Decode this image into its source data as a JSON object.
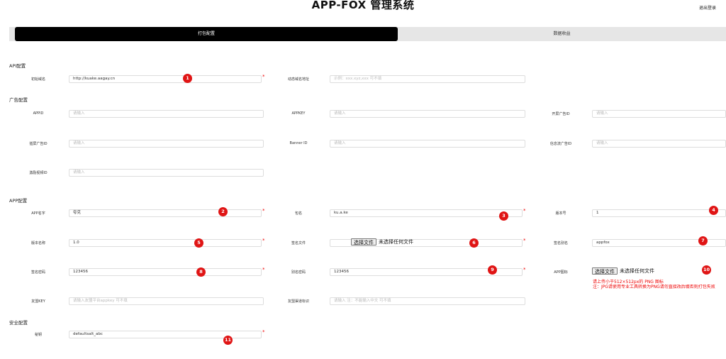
{
  "header": {
    "title": "APP-FOX 管理系统",
    "logout": "退出登录"
  },
  "tabs": [
    {
      "label": "打包配置"
    },
    {
      "label": "数据收益"
    }
  ],
  "sections": {
    "api": "API配置",
    "ad": "广告配置",
    "app": "APP配置",
    "security": "安全配置"
  },
  "fields": {
    "init_domain": {
      "label": "初始域名",
      "value": "http://kuake.aagay.cn"
    },
    "dynamic_domain": {
      "label": "动态域名地址",
      "placeholder": "示例：xxx.xyz,xxx 可不填"
    },
    "appid": {
      "label": "APPID",
      "placeholder": "请输入"
    },
    "appkey": {
      "label": "APPKEY",
      "placeholder": "请输入"
    },
    "splash_ad": {
      "label": "开屏广告ID",
      "placeholder": "请输入"
    },
    "interstitial_ad": {
      "label": "插屏广告ID",
      "placeholder": "请输入"
    },
    "banner_id": {
      "label": "Banner ID",
      "placeholder": "请输入"
    },
    "feed_ad": {
      "label": "信息流广告ID",
      "placeholder": "请输入"
    },
    "reward_video": {
      "label": "激励视频ID",
      "placeholder": "请输入"
    },
    "app_name": {
      "label": "APP名字",
      "value": "夸克"
    },
    "package_name": {
      "label": "包名",
      "value": "ku.a.ke"
    },
    "version_code": {
      "label": "版本号",
      "value": "1"
    },
    "version_name": {
      "label": "版本名称",
      "value": "1.0"
    },
    "sign_file": {
      "label": "签名文件",
      "button": "选择文件",
      "status": "未选择任何文件"
    },
    "sign_alias": {
      "label": "签名别名",
      "value": "appfox"
    },
    "sign_password": {
      "label": "签名密码",
      "value": "123456"
    },
    "alias_password": {
      "label": "别名密码",
      "value": "123456"
    },
    "app_icon": {
      "label": "APP图标",
      "button": "选择文件",
      "status": "未选择任何文件"
    },
    "umeng_key": {
      "label": "友盟KEY",
      "placeholder": "请输入友盟平台appkey 可不填"
    },
    "umeng_channel": {
      "label": "友盟渠道标识",
      "placeholder": "请输入 注：不能输入中文 可不填"
    },
    "secret": {
      "label": "秘钥",
      "value": "defaultsalt_abc"
    }
  },
  "icon_hint": {
    "line1": "请上传小于512×512px的 PNG 图标",
    "line2": "注：JPG请使用专业工具转换为PNG请勿直接改后缀否则打包失败"
  },
  "required_mark": "*",
  "badges": [
    "1",
    "2",
    "3",
    "4",
    "5",
    "6",
    "7",
    "8",
    "9",
    "10",
    "11"
  ]
}
